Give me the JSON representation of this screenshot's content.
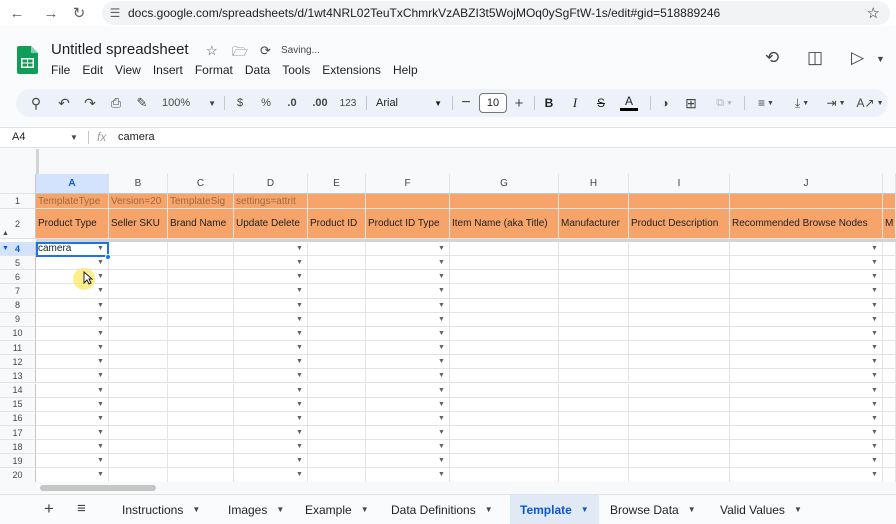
{
  "browser": {
    "url": "docs.google.com/spreadsheets/d/1wt4NRL02TeuTxChmrkVzABZI3t5WojMOq0ySgFtW-1s/edit#gid=518889246"
  },
  "doc": {
    "title": "Untitled spreadsheet",
    "status": "Saving..."
  },
  "menu": [
    "File",
    "Edit",
    "View",
    "Insert",
    "Format",
    "Data",
    "Tools",
    "Extensions",
    "Help"
  ],
  "toolbar": {
    "zoom": "100%",
    "currency": "$",
    "percent": "%",
    "dec_decrease": ".0",
    "dec_increase": ".00",
    "number_format": "123",
    "font": "Arial",
    "font_size": "10"
  },
  "formula_bar": {
    "cell_ref": "A4",
    "fx": "fx",
    "value": "camera"
  },
  "columns": [
    {
      "letter": "A",
      "header": "Product Type",
      "row1": "TemplateType"
    },
    {
      "letter": "B",
      "header": "Seller SKU",
      "row1": "Version=20"
    },
    {
      "letter": "C",
      "header": "Brand Name",
      "row1": "TemplateSig"
    },
    {
      "letter": "D",
      "header": "Update Delete",
      "row1": "settings=attrit"
    },
    {
      "letter": "E",
      "header": "Product ID",
      "row1": ""
    },
    {
      "letter": "F",
      "header": "Product ID Type",
      "row1": ""
    },
    {
      "letter": "G",
      "header": "Item Name (aka Title)",
      "row1": ""
    },
    {
      "letter": "H",
      "header": "Manufacturer",
      "row1": ""
    },
    {
      "letter": "I",
      "header": "Product Description",
      "row1": ""
    },
    {
      "letter": "J",
      "header": "Recommended Browse Nodes",
      "row1": ""
    },
    {
      "letter": "",
      "header": "M",
      "row1": ""
    }
  ],
  "rows": [
    "1",
    "2",
    "4",
    "5",
    "6",
    "7",
    "8",
    "9",
    "10",
    "11",
    "12",
    "13",
    "14",
    "15",
    "16",
    "17",
    "18",
    "19",
    "20"
  ],
  "cells": {
    "a4": "camera"
  },
  "sheets": [
    {
      "name": "Instructions",
      "active": false
    },
    {
      "name": "Images",
      "active": false
    },
    {
      "name": "Example",
      "active": false
    },
    {
      "name": "Data Definitions",
      "active": false
    },
    {
      "name": "Template",
      "active": true
    },
    {
      "name": "Browse Data",
      "active": false
    },
    {
      "name": "Valid Values",
      "active": false
    }
  ],
  "colors": {
    "header_orange": "#f6a46a",
    "selection_blue": "#1a73e8",
    "sheets_green": "#0f9d58"
  }
}
